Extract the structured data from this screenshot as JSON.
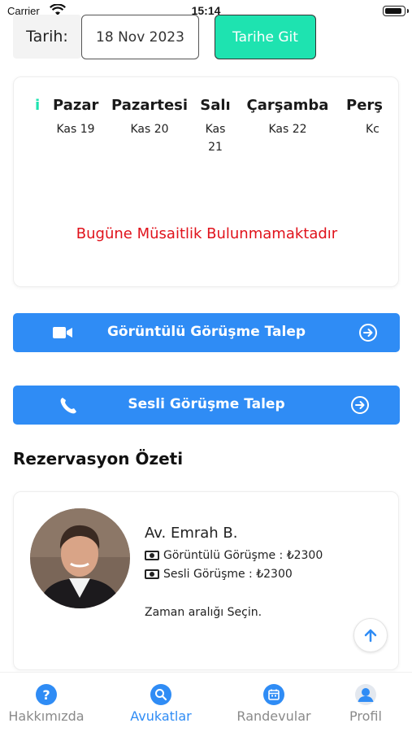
{
  "status_bar": {
    "carrier": "Carrier",
    "time": "15:14"
  },
  "date_picker": {
    "label": "Tarih:",
    "value": "18 Nov 2023",
    "go_button": "Tarihe Git"
  },
  "day_selector": {
    "partial_left": "i",
    "days": [
      {
        "name": "Pazar",
        "date": "Kas 19"
      },
      {
        "name": "Pazartesi",
        "date": "Kas 20"
      },
      {
        "name": "Salı",
        "date": "Kas 21"
      },
      {
        "name": "Çarşamba",
        "date": "Kas 22"
      },
      {
        "name": "Perş",
        "date": "Kc"
      }
    ],
    "no_availability": "Bugüne Müsaitlik Bulunmamaktadır"
  },
  "actions": {
    "video": {
      "label": "Görüntülü Görüşme Talep",
      "icon": "video-camera-icon"
    },
    "voice": {
      "label": "Sesli Görüşme Talep",
      "icon": "phone-icon"
    }
  },
  "summary": {
    "title": "Rezervasyon Özeti",
    "lawyer_name": "Av. Emrah B.",
    "video_price": "Görüntülü Görüşme : ₺2300",
    "voice_price": "Sesli Görüşme : ₺2300",
    "pick_time": "Zaman aralığı Seçin."
  },
  "tabbar": {
    "items": [
      {
        "label": "Hakkımızda",
        "icon": "question-icon",
        "active": false
      },
      {
        "label": "Avukatlar",
        "icon": "search-icon",
        "active": true
      },
      {
        "label": "Randevular",
        "icon": "calendar-icon",
        "active": false
      },
      {
        "label": "Profil",
        "icon": "user-icon",
        "active": false
      }
    ]
  },
  "colors": {
    "accent": "#2f8cf5",
    "go_button": "#1ee3b0",
    "error": "#e0121b"
  }
}
